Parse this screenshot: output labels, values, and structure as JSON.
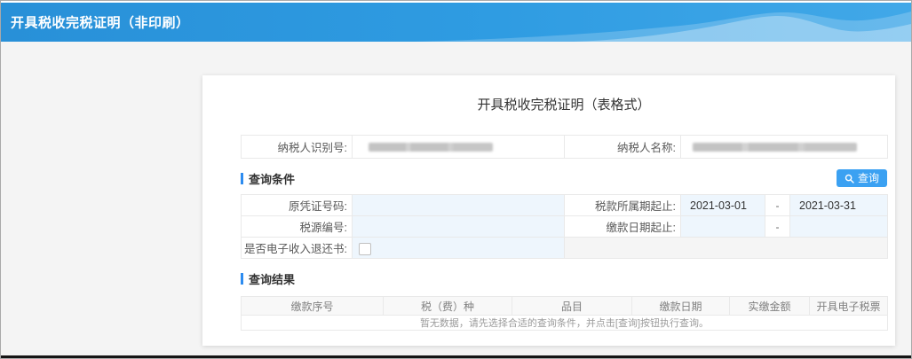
{
  "page": {
    "header_title": "开具税收完税证明（非印刷）"
  },
  "card": {
    "title": "开具税收完税证明（表格式）"
  },
  "taxpayer": {
    "id_label": "纳税人识别号:",
    "name_label": "纳税人名称:",
    "id_value_redacted": true,
    "name_value_redacted": true
  },
  "query_conditions": {
    "section_title": "查询条件",
    "button_label": "查询",
    "original_voucher_label": "原凭证号码:",
    "original_voucher_value": "",
    "tax_period_label": "税款所属期起止:",
    "tax_period_start": "2021-03-01",
    "tax_period_end": "2021-03-31",
    "date_separator": "-",
    "tax_source_label": "税源编号:",
    "tax_source_value": "",
    "payment_date_label": "缴款日期起止:",
    "payment_date_start": "",
    "payment_date_end": "",
    "e_refund_label": "是否电子收入退还书:",
    "e_refund_checked": false
  },
  "query_results": {
    "section_title": "查询结果",
    "columns": [
      "缴款序号",
      "税（费）种",
      "品目",
      "缴款日期",
      "实缴金额",
      "开具电子税票"
    ],
    "empty_message": "暂无数据，请先选择合适的查询条件，并点击[查询]按钮执行查询。"
  },
  "colors": {
    "header_blue": "#2f9ce2",
    "accent_bar_blue": "#2d8cf0",
    "button_blue": "#3ba1f2",
    "input_background": "#eef6fd",
    "body_background": "#f4f4f4"
  }
}
